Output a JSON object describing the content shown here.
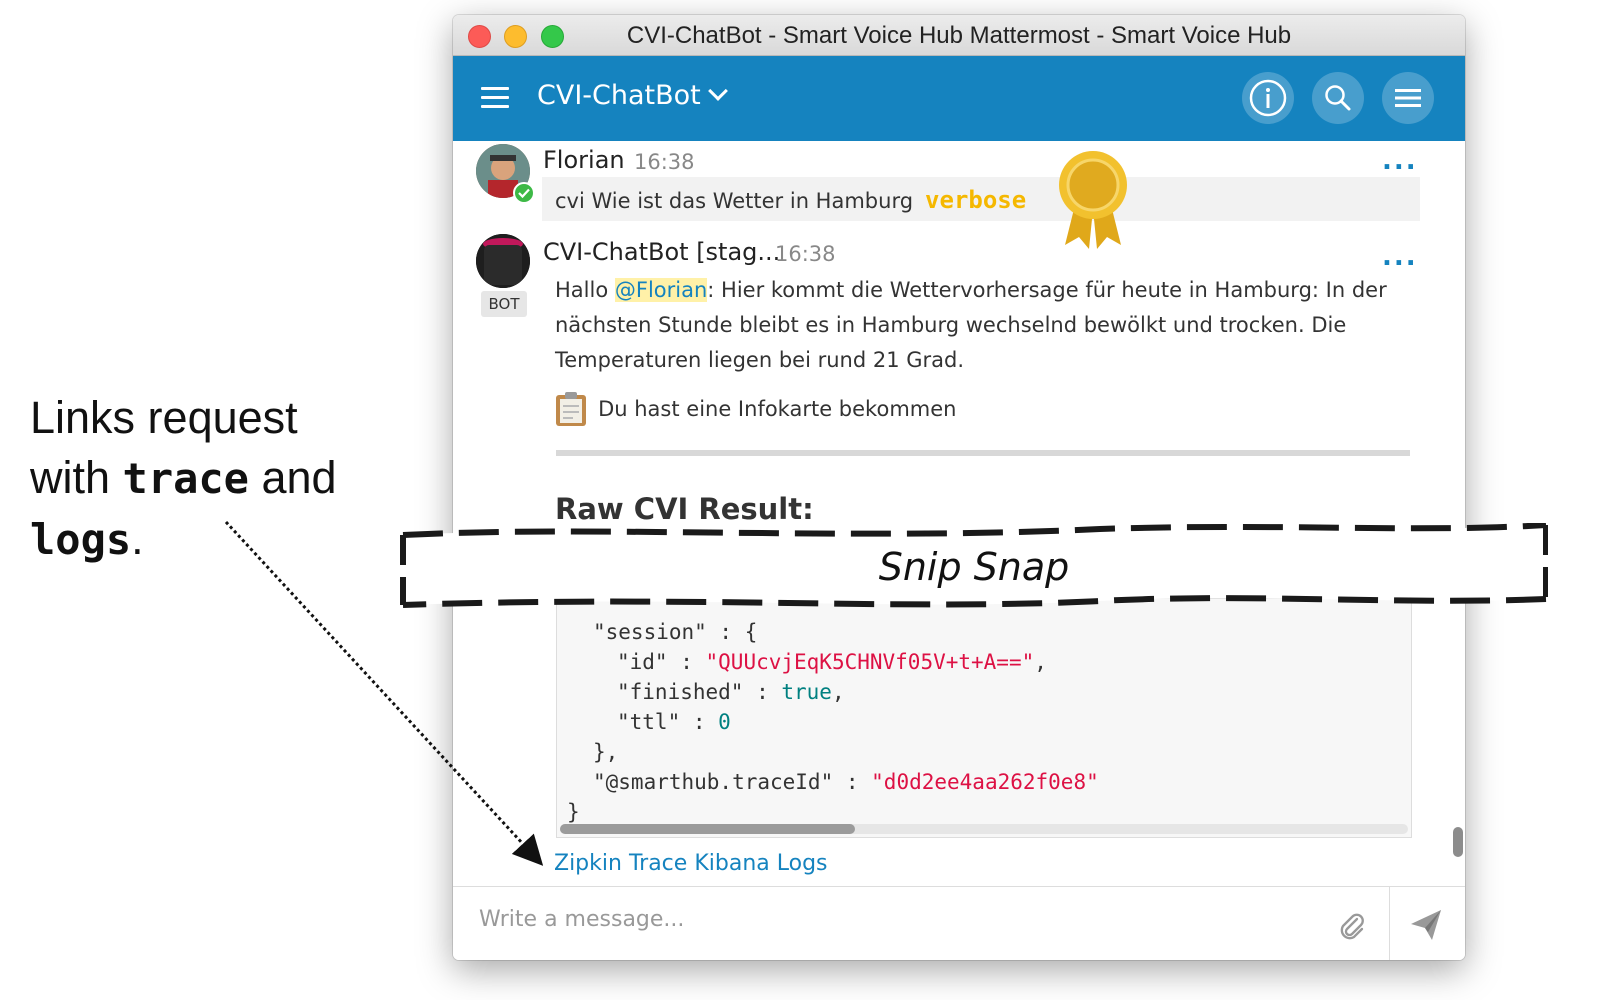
{
  "annotation": {
    "line1": "Links request",
    "line2_prefix": "with ",
    "line2_code": "trace",
    "line2_suffix": " and",
    "line3_code": "logs",
    "line3_suffix": "."
  },
  "window": {
    "title": "CVI-ChatBot - Smart Voice Hub Mattermost - Smart Voice Hub"
  },
  "header": {
    "channel_name": "CVI-ChatBot",
    "icons": [
      "menu-icon",
      "info-icon",
      "search-icon",
      "more-menu-icon"
    ]
  },
  "posts": [
    {
      "author": "Florian",
      "time": "16:38",
      "text": "cvi Wie ist das Wetter in Hamburg",
      "flag": "verbose",
      "more": "..."
    },
    {
      "author": "CVI-ChatBot [stag...",
      "time": "16:38",
      "badge": "BOT",
      "more": "...",
      "greeting": "Hallo ",
      "mention": "@Florian",
      "line1_rest": ": Hier kommt die Wettervorhersage für heute in Hamburg: In der",
      "line2": "nächsten Stunde bleibt es in Hamburg wechselnd bewölkt und trocken. Die",
      "line3": "Temperaturen liegen bei rund 21 Grad.",
      "card_text": "Du hast eine Infokarte bekommen",
      "raw_heading": "Raw CVI Result:",
      "code": {
        "l0": "\"session\" : {",
        "l1_key": "\"id\" : ",
        "l1_val": "\"QUUcvjEqK5CHNVf05V+t+A==\"",
        "l1_end": ",",
        "l2_key": "\"finished\" : ",
        "l2_val": "true",
        "l2_end": ",",
        "l3_key": "\"ttl\" : ",
        "l3_val": "0",
        "l4": "},",
        "l5_key": "\"@smarthub.traceId\" : ",
        "l5_val": "\"d0d2ee4aa262f0e8\"",
        "l6": "}"
      },
      "links": [
        "Zipkin",
        "Trace",
        "Kibana",
        "Logs"
      ]
    }
  ],
  "composer": {
    "placeholder": "Write a message..."
  },
  "overlay": {
    "label": "Snip Snap"
  }
}
